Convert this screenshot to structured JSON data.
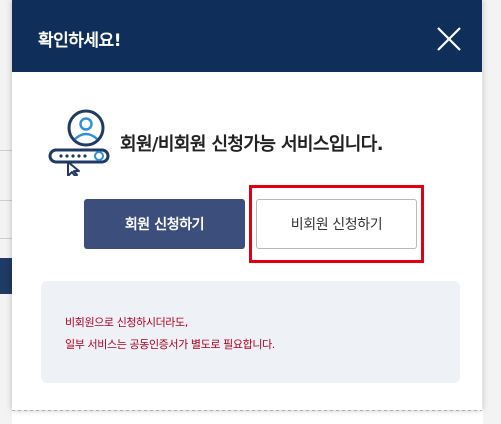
{
  "modal": {
    "title": "확인하세요!",
    "close_icon": "close-icon",
    "message": "회원/비회원 신청가능 서비스입니다.",
    "illustration_icon": "user-key-icon",
    "buttons": {
      "member_label": "회원 신청하기",
      "guest_label": "비회원 신청하기"
    },
    "notice": {
      "line1": "비회원으로 신청하시더라도,",
      "line2": "일부 서비스는 공동인증서가 별도로 필요합니다."
    }
  },
  "colors": {
    "header_bg": "#0f2f5a",
    "member_button_bg": "#3b4e7c",
    "highlight_border": "#e0000f",
    "notice_bg": "#eef2f7",
    "notice_text": "#b00020"
  }
}
